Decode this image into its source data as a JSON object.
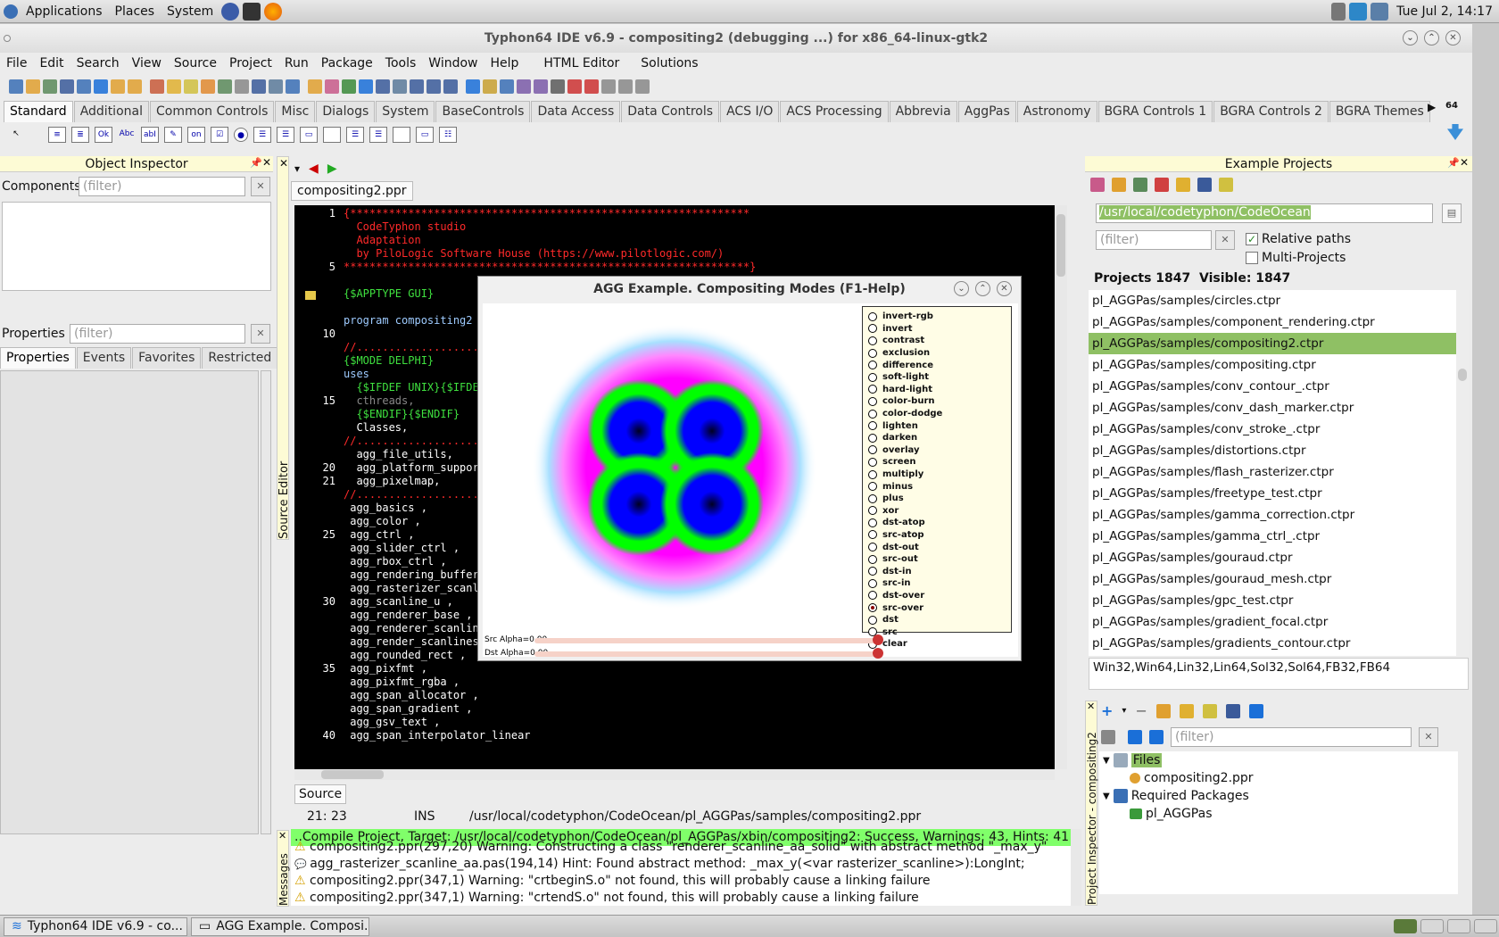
{
  "top_panel": {
    "menus": [
      "Applications",
      "Places",
      "System"
    ],
    "clock": "Tue Jul  2, 14:17"
  },
  "window": {
    "title": "Typhon64 IDE v6.9 - compositing2 (debugging ...) for x86_64-linux-gtk2"
  },
  "menubar": [
    "File",
    "Edit",
    "Search",
    "View",
    "Source",
    "Project",
    "Run",
    "Package",
    "Tools",
    "Window",
    "Help",
    "HTML Editor",
    "Solutions"
  ],
  "palette_tabs": [
    "Standard",
    "Additional",
    "Common Controls",
    "Misc",
    "Dialogs",
    "System",
    "BaseControls",
    "Data Access",
    "Data Controls",
    "ACS I/O",
    "ACS Processing",
    "Abbrevia",
    "AggPas",
    "Astronomy",
    "BGRA Controls 1",
    "BGRA Controls 2",
    "BGRA Themes"
  ],
  "palette_side": "64",
  "palette_icons": [
    "Ok",
    "Abc",
    "abI",
    "on"
  ],
  "object_inspector": {
    "title": "Object Inspector",
    "components_label": "Components",
    "filter_placeholder": "(filter)",
    "properties_label": "Properties",
    "tabs": [
      "Properties",
      "Events",
      "Favorites",
      "Restricted"
    ]
  },
  "source_editor": {
    "side_label": "Source Editor",
    "tab": "compositing2.ppr",
    "bottom_tab": "Source",
    "status_pos": "21: 23",
    "status_mode": "INS",
    "status_path": "/usr/local/codetyphon/CodeOcean/pl_AGGPas/samples/compositing2.ppr",
    "lines": [
      {
        "n": "1",
        "t": "{**************************************************************",
        "c": "#ff2a2a"
      },
      {
        "n": "",
        "t": "  CodeTyphon studio",
        "c": "#ff2a2a"
      },
      {
        "n": "",
        "t": "  Adaptation",
        "c": "#ff2a2a"
      },
      {
        "n": "",
        "t": "  by PiloLogic Software House (https://www.pilotlogic.com/)",
        "c": "#ff2a2a"
      },
      {
        "n": "5",
        "t": "***************************************************************}",
        "c": "#ff2a2a"
      },
      {
        "n": "",
        "t": "",
        "c": "#fff"
      },
      {
        "n": "",
        "t": "{$APPTYPE GUI}",
        "c": "#3fe03f"
      },
      {
        "n": "",
        "t": "",
        "c": "#fff"
      },
      {
        "n": "",
        "t": "program compositing2",
        "c": "#9ecbff"
      },
      {
        "n": "10",
        "t": "",
        "c": "#fff"
      },
      {
        "n": "",
        "t": "//.........................",
        "c": "#ff2a2a"
      },
      {
        "n": "",
        "t": "{$MODE DELPHI}",
        "c": "#3fe03f"
      },
      {
        "n": "",
        "t": "uses",
        "c": "#9ecbff"
      },
      {
        "n": "",
        "t": "  {$IFDEF UNIX}{$IFDE",
        "c": "#3fe03f"
      },
      {
        "n": "15",
        "t": "  cthreads,",
        "c": "#888"
      },
      {
        "n": "",
        "t": "  {$ENDIF}{$ENDIF}",
        "c": "#3fe03f"
      },
      {
        "n": "",
        "t": "  Classes,",
        "c": "#fff"
      },
      {
        "n": "",
        "t": "//.........................",
        "c": "#ff2a2a"
      },
      {
        "n": "",
        "t": "  agg_file_utils,",
        "c": "#fff"
      },
      {
        "n": "20",
        "t": "  agg_platform_suppor",
        "c": "#fff"
      },
      {
        "n": "21",
        "t": "  agg_pixelmap,",
        "c": "#fff"
      },
      {
        "n": "",
        "t": "//.........................",
        "c": "#ff2a2a"
      },
      {
        "n": "",
        "t": " agg_basics ,",
        "c": "#fff"
      },
      {
        "n": "",
        "t": " agg_color ,",
        "c": "#fff"
      },
      {
        "n": "25",
        "t": " agg_ctrl ,",
        "c": "#fff"
      },
      {
        "n": "",
        "t": " agg_slider_ctrl ,",
        "c": "#fff"
      },
      {
        "n": "",
        "t": " agg_rbox_ctrl ,",
        "c": "#fff"
      },
      {
        "n": "",
        "t": " agg_rendering_buffer",
        "c": "#fff"
      },
      {
        "n": "",
        "t": " agg_rasterizer_scanl",
        "c": "#fff"
      },
      {
        "n": "30",
        "t": " agg_scanline_u ,",
        "c": "#fff"
      },
      {
        "n": "",
        "t": " agg_renderer_base ,",
        "c": "#fff"
      },
      {
        "n": "",
        "t": " agg_renderer_scanlin",
        "c": "#fff"
      },
      {
        "n": "",
        "t": " agg_render_scanlines ,",
        "c": "#fff"
      },
      {
        "n": "",
        "t": " agg_rounded_rect ,",
        "c": "#fff"
      },
      {
        "n": "35",
        "t": " agg_pixfmt ,",
        "c": "#fff"
      },
      {
        "n": "",
        "t": " agg_pixfmt_rgba ,",
        "c": "#fff"
      },
      {
        "n": "",
        "t": " agg_span_allocator ,",
        "c": "#fff"
      },
      {
        "n": "",
        "t": " agg_span_gradient ,",
        "c": "#fff"
      },
      {
        "n": "",
        "t": " agg_gsv_text ,",
        "c": "#fff"
      },
      {
        "n": "40",
        "t": " agg_span_interpolator_linear",
        "c": "#fff"
      }
    ]
  },
  "agg_window": {
    "title": "AGG Example. Compositing Modes (F1-Help)",
    "modes": [
      "invert-rgb",
      "invert",
      "contrast",
      "exclusion",
      "difference",
      "soft-light",
      "hard-light",
      "color-burn",
      "color-dodge",
      "lighten",
      "darken",
      "overlay",
      "screen",
      "multiply",
      "minus",
      "plus",
      "xor",
      "dst-atop",
      "src-atop",
      "dst-out",
      "src-out",
      "dst-in",
      "src-in",
      "dst-over",
      "src-over",
      "dst",
      "src",
      "clear"
    ],
    "selected_mode": "src-over",
    "src_alpha_label": "Src Alpha=0.00",
    "dst_alpha_label": "Dst Alpha=0.00"
  },
  "messages": {
    "side_label": "Messages",
    "header": "..Compile Project, Target: /usr/local/codetyphon/CodeOcean/pl_AGGPas/xbin/compositing2: Success, Warnings: 43, Hints: 41",
    "lines": [
      "compositing2.ppr(297,20) Warning: Constructing a class \"renderer_scanline_aa_solid\" with abstract method \"_max_y\"",
      "agg_rasterizer_scanline_aa.pas(194,14) Hint: Found abstract method: _max_y(<var rasterizer_scanline>):LongInt;",
      "compositing2.ppr(347,1) Warning: \"crtbeginS.o\" not found, this will probably cause a linking failure",
      "compositing2.ppr(347,1) Warning: \"crtendS.o\" not found, this will probably cause a linking failure"
    ]
  },
  "example_projects": {
    "title": "Example Projects",
    "path": "/usr/local/codetyphon/CodeOcean",
    "filter_placeholder": "(filter)",
    "relative_paths": "Relative paths",
    "multi_projects": "Multi-Projects",
    "counts": "Projects 1847  Visible: 1847",
    "items": [
      "pl_AGGPas/samples/circles.ctpr",
      "pl_AGGPas/samples/component_rendering.ctpr",
      "pl_AGGPas/samples/compositing2.ctpr",
      "pl_AGGPas/samples/compositing.ctpr",
      "pl_AGGPas/samples/conv_contour_.ctpr",
      "pl_AGGPas/samples/conv_dash_marker.ctpr",
      "pl_AGGPas/samples/conv_stroke_.ctpr",
      "pl_AGGPas/samples/distortions.ctpr",
      "pl_AGGPas/samples/flash_rasterizer.ctpr",
      "pl_AGGPas/samples/freetype_test.ctpr",
      "pl_AGGPas/samples/gamma_correction.ctpr",
      "pl_AGGPas/samples/gamma_ctrl_.ctpr",
      "pl_AGGPas/samples/gouraud.ctpr",
      "pl_AGGPas/samples/gouraud_mesh.ctpr",
      "pl_AGGPas/samples/gpc_test.ctpr",
      "pl_AGGPas/samples/gradient_focal.ctpr",
      "pl_AGGPas/samples/gradients_contour.ctpr"
    ],
    "selected_index": 2,
    "platforms": "Win32,Win64,Lin32,Lin64,Sol32,Sol64,FB32,FB64"
  },
  "project_inspector": {
    "side_label": "Project Inspector - compositing2",
    "filter_placeholder": "(filter)",
    "files_label": "Files",
    "file": "compositing2.ppr",
    "required_label": "Required Packages",
    "package": "pl_AGGPas"
  },
  "taskbar": [
    "Typhon64 IDE v6.9 - co...",
    "AGG Example. Composi..."
  ]
}
